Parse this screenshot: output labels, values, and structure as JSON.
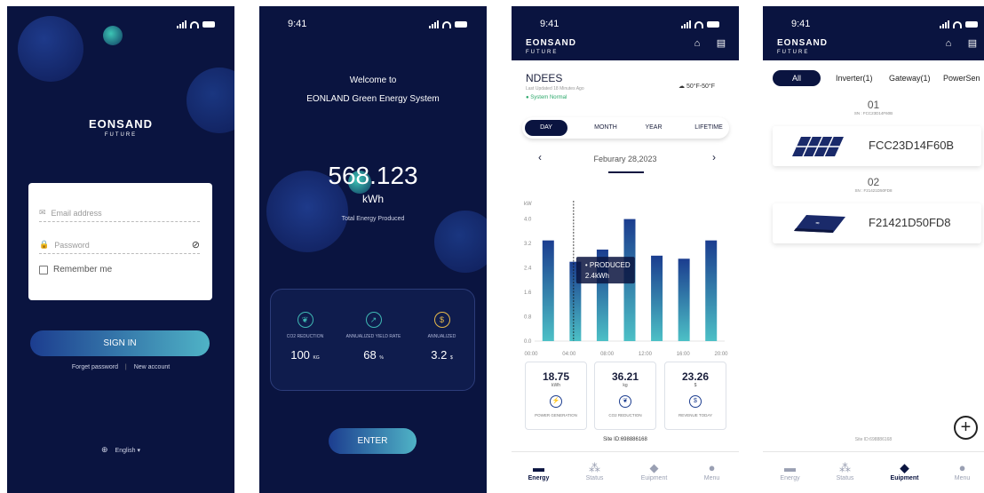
{
  "status_time": "9:41",
  "brand": {
    "name": "EONSAND",
    "sub": "FUTURE"
  },
  "login": {
    "email_placeholder": "Email address",
    "password_placeholder": "Password",
    "remember_label": "Remember me",
    "signin_label": "SIGN IN",
    "forgot_label": "Forget password",
    "new_account_label": "New account",
    "language": "English"
  },
  "welcome": {
    "line1": "Welcome to",
    "line2": "EONLAND Green Energy System",
    "total_value": "568.123",
    "total_unit": "kWh",
    "total_label": "Total Energy Produced",
    "stats": [
      {
        "label": "CO2 REDUCTION",
        "value": "100",
        "unit": "KG",
        "icon": "leaf-icon"
      },
      {
        "label": "ANNUALIZED YIELD RATE",
        "value": "68",
        "unit": "%",
        "icon": "growth-icon"
      },
      {
        "label": "ANNUALIZED",
        "value": "3.2",
        "unit": "$",
        "icon": "dollar-icon"
      }
    ],
    "enter_label": "ENTER"
  },
  "energy": {
    "site_name": "NDEES",
    "updated": "Last Updated 18 Minutes Ago",
    "system_status": "System Normal",
    "weather": "50°F-50°F",
    "tabs": [
      "DAY",
      "MONTH",
      "YEAR",
      "LIFETIME"
    ],
    "date": "Feburary 28,2023",
    "tooltip_label": "PRODUCED",
    "tooltip_value": "2.4kWh",
    "cards": [
      {
        "value": "18.75",
        "unit": "kWh",
        "label": "POWER GENERATION",
        "icon": "power-icon"
      },
      {
        "value": "36.21",
        "unit": "kg",
        "label": "CO2 REDUCTION",
        "icon": "leaf-icon"
      },
      {
        "value": "23.26",
        "unit": "$",
        "label": "REVENUE TODAY",
        "icon": "dollar-icon"
      }
    ],
    "site_id": "Site ID:698886168"
  },
  "equipment": {
    "filters": [
      "All",
      "Inverter(1)",
      "Gateway(1)",
      "PowerSen"
    ],
    "devices": [
      {
        "index": "01",
        "sn": "SN : FCC23D14F60B",
        "name": "FCC23D14F60B"
      },
      {
        "index": "02",
        "sn": "SN : F21421D50FD8",
        "name": "F21421D50FD8"
      }
    ],
    "site_id": "Site ID:698886168"
  },
  "nav": [
    "Energy",
    "Status",
    "Euipment",
    "Menu"
  ],
  "chart_data": {
    "type": "bar",
    "ylabel": "kW",
    "yticks": [
      "0.0",
      "0.8",
      "1.6",
      "2.4",
      "3.2",
      "4.0"
    ],
    "xticks": [
      "00:00",
      "04:00",
      "08:00",
      "12:00",
      "16:00",
      "20:00"
    ],
    "ylim": [
      0,
      4.6
    ],
    "values": [
      3.3,
      2.6,
      3.0,
      4.0,
      2.8,
      2.7,
      3.3
    ],
    "highlight_index": 1
  }
}
